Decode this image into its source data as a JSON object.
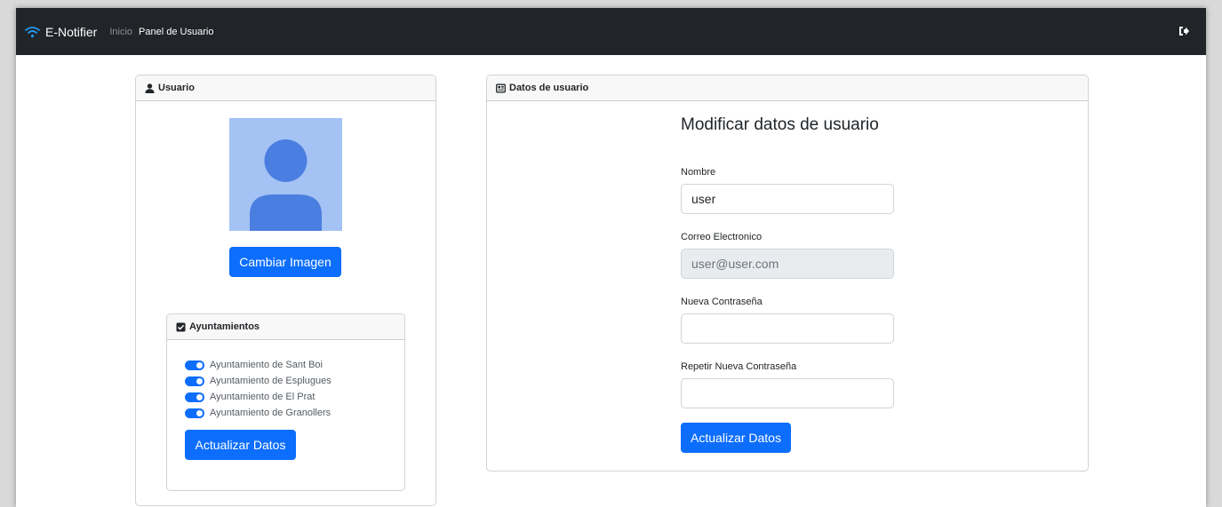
{
  "navbar": {
    "brand": "E-Notifier",
    "links": [
      "Inicio",
      "Panel de Usuario"
    ],
    "logout_icon": "sign-out-icon"
  },
  "user_card": {
    "title": "Usuario",
    "change_image_label": "Cambiar Imagen",
    "ayuntamientos": {
      "title": "Ayuntamientos",
      "items": [
        {
          "label": "Ayuntamiento de Sant Boi",
          "enabled": true
        },
        {
          "label": "Ayuntamiento de Esplugues",
          "enabled": true
        },
        {
          "label": "Ayuntamiento de El Prat",
          "enabled": true
        },
        {
          "label": "Ayuntamiento de Granollers",
          "enabled": true
        }
      ],
      "update_label": "Actualizar Datos"
    }
  },
  "data_card": {
    "title": "Datos de usuario",
    "form_title": "Modificar datos de usuario",
    "fields": [
      {
        "label": "Nombre",
        "value": "user",
        "placeholder": ""
      },
      {
        "label": "Correo Electronico",
        "value": "user@user.com",
        "placeholder": ""
      },
      {
        "label": "Nueva Contraseña",
        "value": "",
        "placeholder": ""
      },
      {
        "label": "Repetir Nueva Contraseña",
        "value": "",
        "placeholder": ""
      }
    ],
    "update_label": "Actualizar Datos"
  },
  "colors": {
    "navbar": "#212529",
    "primary": "#0d6efd",
    "avatar_bg": "#a4c2f4",
    "avatar_fg": "#4a7ee0"
  }
}
